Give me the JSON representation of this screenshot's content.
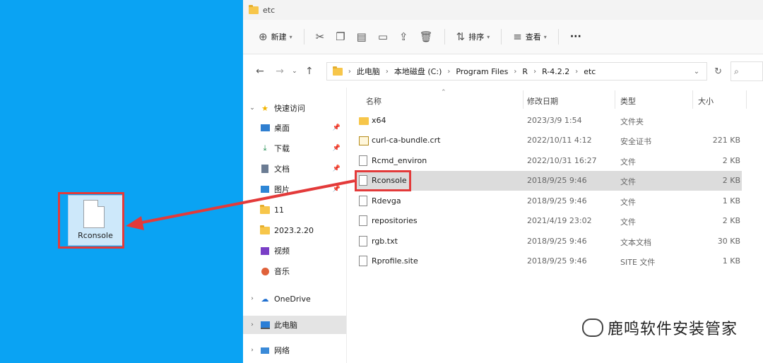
{
  "desktop": {
    "file_label": "Rconsole"
  },
  "window": {
    "title": "etc"
  },
  "toolbar": {
    "new_label": "新建",
    "sort_label": "排序",
    "view_label": "查看",
    "more_label": "···"
  },
  "address": {
    "crumbs": [
      "此电脑",
      "本地磁盘 (C:)",
      "Program Files",
      "R",
      "R-4.2.2",
      "etc"
    ]
  },
  "nav": {
    "quick_access": "快速访问",
    "desktop": "桌面",
    "downloads": "下载",
    "documents": "文档",
    "pictures": "图片",
    "folder_11": "11",
    "folder_2023": "2023.2.20",
    "videos": "视频",
    "music": "音乐",
    "onedrive": "OneDrive",
    "this_pc": "此电脑",
    "network": "网络"
  },
  "columns": {
    "name": "名称",
    "date": "修改日期",
    "type": "类型",
    "size": "大小"
  },
  "files": [
    {
      "name": "x64",
      "date": "2023/3/9 1:54",
      "type": "文件夹",
      "size": "",
      "icon": "folder"
    },
    {
      "name": "curl-ca-bundle.crt",
      "date": "2022/10/11 4:12",
      "type": "安全证书",
      "size": "221 KB",
      "icon": "cert"
    },
    {
      "name": "Rcmd_environ",
      "date": "2022/10/31 16:27",
      "type": "文件",
      "size": "2 KB",
      "icon": "doc"
    },
    {
      "name": "Rconsole",
      "date": "2018/9/25 9:46",
      "type": "文件",
      "size": "2 KB",
      "icon": "doc"
    },
    {
      "name": "Rdevga",
      "date": "2018/9/25 9:46",
      "type": "文件",
      "size": "1 KB",
      "icon": "doc"
    },
    {
      "name": "repositories",
      "date": "2021/4/19 23:02",
      "type": "文件",
      "size": "2 KB",
      "icon": "doc"
    },
    {
      "name": "rgb.txt",
      "date": "2018/9/25 9:46",
      "type": "文本文档",
      "size": "30 KB",
      "icon": "doc"
    },
    {
      "name": "Rprofile.site",
      "date": "2018/9/25 9:46",
      "type": "SITE 文件",
      "size": "1 KB",
      "icon": "doc"
    }
  ],
  "watermark": {
    "text": "鹿鸣软件安装管家"
  },
  "colors": {
    "desktop": "#0aa3f3",
    "highlight": "#e33a3a"
  }
}
